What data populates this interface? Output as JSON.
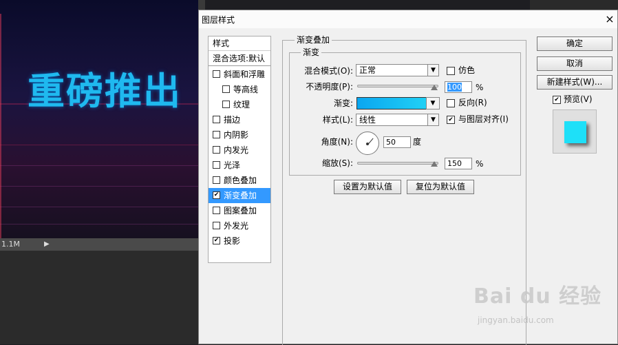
{
  "canvas": {
    "title": "重磅推出"
  },
  "status_bar": {
    "size": "1.1M",
    "arrow_icon": "play-triangle-icon"
  },
  "dialog": {
    "title": "图层样式",
    "close": "×",
    "style_list": {
      "header": "样式",
      "blend_options": "混合选项:默认",
      "items": [
        {
          "label": "斜面和浮雕",
          "checked": false,
          "indent": false
        },
        {
          "label": "等高线",
          "checked": false,
          "indent": true
        },
        {
          "label": "纹理",
          "checked": false,
          "indent": true
        },
        {
          "label": "描边",
          "checked": false,
          "indent": false
        },
        {
          "label": "内阴影",
          "checked": false,
          "indent": false
        },
        {
          "label": "内发光",
          "checked": false,
          "indent": false
        },
        {
          "label": "光泽",
          "checked": false,
          "indent": false
        },
        {
          "label": "颜色叠加",
          "checked": false,
          "indent": false
        },
        {
          "label": "渐变叠加",
          "checked": true,
          "indent": false,
          "selected": true
        },
        {
          "label": "图案叠加",
          "checked": false,
          "indent": false
        },
        {
          "label": "外发光",
          "checked": false,
          "indent": false
        },
        {
          "label": "投影",
          "checked": true,
          "indent": false
        }
      ]
    },
    "gradient_overlay": {
      "outer_title": "渐变叠加",
      "inner_title": "渐变",
      "blend_mode_label": "混合模式(O):",
      "blend_mode_value": "正常",
      "dither_label": "仿色",
      "dither_checked": false,
      "opacity_label": "不透明度(P):",
      "opacity_value": "100",
      "opacity_unit": "%",
      "opacity_level": 1.0,
      "gradient_label": "渐变:",
      "gradient_colors": [
        "#0aa6f0",
        "#24d8f6"
      ],
      "reverse_label": "反向(R)",
      "reverse_checked": false,
      "style_label": "样式(L):",
      "style_value": "线性",
      "align_label": "与图层对齐(I)",
      "align_checked": true,
      "angle_label": "角度(N):",
      "angle_value": "50",
      "angle_unit": "度",
      "scale_label": "缩放(S):",
      "scale_value": "150",
      "scale_unit": "%",
      "scale_level": 1.0,
      "make_default": "设置为默认值",
      "reset_default": "复位为默认值"
    },
    "buttons": {
      "ok": "确定",
      "cancel": "取消",
      "new_style": "新建样式(W)...",
      "preview_label": "预览(V)",
      "preview_checked": true
    },
    "preview_color": "#1ee0f8"
  },
  "watermark": {
    "text": "Bai du 经验",
    "sub": "jingyan.baidu.com"
  },
  "colors": {
    "selection": "#3399ff",
    "canvas_text": "#1fb9ef"
  }
}
